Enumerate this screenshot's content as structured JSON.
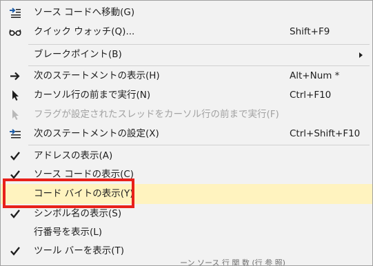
{
  "menu": {
    "items": [
      {
        "label": "ソース コードへ移動(G)",
        "icon": "arrow-to-code-icon"
      },
      {
        "label": "クイック ウォッチ(Q)...",
        "shortcut": "Shift+F9",
        "icon": "glasses-icon"
      },
      {
        "label": "ブレークポイント(B)",
        "submenu": true
      },
      {
        "label": "次のステートメントの表示(H)",
        "shortcut": "Alt+Num *",
        "icon": "right-arrow-icon"
      },
      {
        "label": "カーソル行の前まで実行(N)",
        "shortcut": "Ctrl+F10",
        "icon": "cursor-icon"
      },
      {
        "label": "フラグが設定されたスレッドをカーソル行の前まで実行(F)",
        "disabled": true,
        "icon": "cursor-disabled-icon"
      },
      {
        "label": "次のステートメントの設定(X)",
        "shortcut": "Ctrl+Shift+F10",
        "icon": "set-next-statement-icon"
      },
      {
        "label": "アドレスの表示(A)",
        "checked": true
      },
      {
        "label": "ソース コードの表示(C)",
        "checked": true
      },
      {
        "label": "コード バイトの表示(Y)",
        "highlighted": true
      },
      {
        "label": "シンボル名の表示(S)",
        "checked": true
      },
      {
        "label": "行番号を表示(L)"
      },
      {
        "label": "ツール バーを表示(T)",
        "checked": true
      }
    ]
  },
  "colors": {
    "menu_bg": "#f2f2f2",
    "highlight_bg": "#fff3bf",
    "annotation_box": "#e8201a",
    "text": "#1e1e1e",
    "disabled_text": "#a2a2a2",
    "icon_blue": "#1f5ea8"
  },
  "background_text": "ーン  ソース 行 関 数 (行 参 照)"
}
